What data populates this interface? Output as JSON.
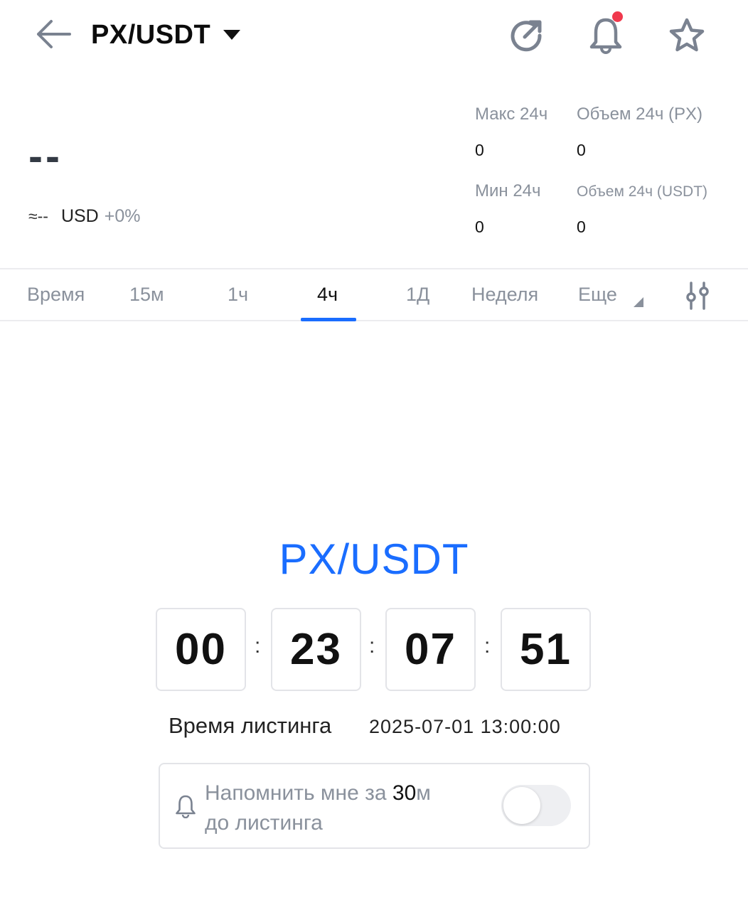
{
  "header": {
    "pair": "PX/USDT",
    "has_notification": true,
    "notification_color": "#f0394d"
  },
  "price": {
    "last": "--",
    "approx_symbol": "≈--",
    "currency": "USD",
    "change": "+0%"
  },
  "stats": {
    "high_label": "Макс 24ч",
    "high_value": "0",
    "vol_base_label": "Объем 24ч (PX)",
    "vol_base_value": "0",
    "low_label": "Мин 24ч",
    "low_value": "0",
    "vol_quote_label": "Объем 24ч  (USDT)",
    "vol_quote_value": "0"
  },
  "tabs": [
    {
      "label": "Время",
      "active": false
    },
    {
      "label": "15м",
      "active": false
    },
    {
      "label": "1ч",
      "active": false
    },
    {
      "label": "4ч",
      "active": true
    },
    {
      "label": "1Д",
      "active": false
    },
    {
      "label": "Неделя",
      "active": false
    },
    {
      "label": "Еще",
      "active": false
    }
  ],
  "countdown": {
    "pair": "PX/USDT",
    "days": "00",
    "hours": "23",
    "minutes": "07",
    "seconds": "51",
    "separator": ":",
    "listing_label": "Время листинга",
    "listing_time": "2025-07-01 13:00:00"
  },
  "reminder": {
    "text_before": "Напомнить мне за ",
    "minutes": "30",
    "text_after": "м",
    "line2": "до листинга",
    "enabled": false
  },
  "colors": {
    "accent": "#1a6dff",
    "muted": "#8a919c"
  }
}
